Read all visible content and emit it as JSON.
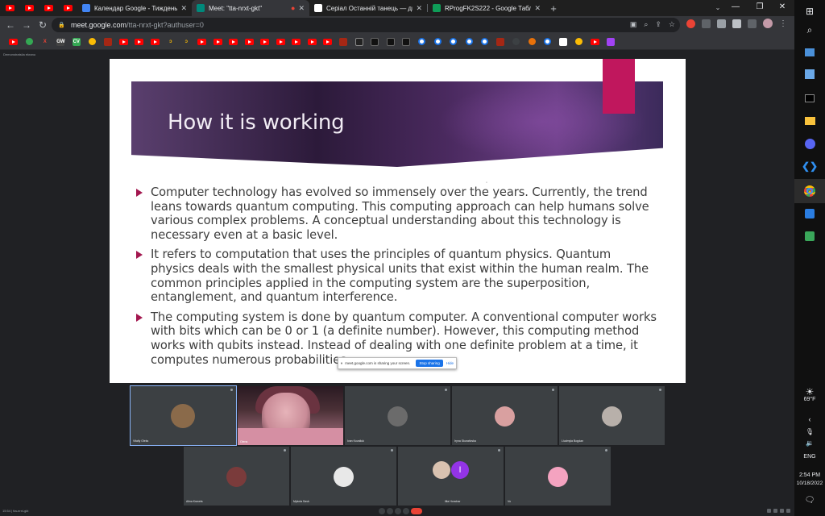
{
  "browser": {
    "tabs": [
      {
        "title": "Календар Google - Тиждень (16",
        "icon": "google-calendar-icon",
        "color": "#4285f4"
      },
      {
        "title": "Meet: \"tta-nrxt-gkt\"",
        "icon": "google-meet-icon",
        "color": "#00897b",
        "active": true
      },
      {
        "title": "Серіал Останній танець — диво",
        "icon": "mx-site-icon",
        "color": "#ffffff"
      },
      {
        "title": "RProgFK2S222 - Google Таблиці",
        "icon": "google-sheets-icon",
        "color": "#0f9d58"
      }
    ],
    "new_tab_label": "+",
    "window_controls": {
      "minimize": "—",
      "maximize": "❐",
      "close": "✕"
    },
    "url_host": "meet.google.com",
    "url_path": "/tta-nrxt-gkt?authuser=0"
  },
  "meet": {
    "top_label": "Demonstratsiia ekranu",
    "slide": {
      "title": "How it is working",
      "bullets": [
        "Computer technology has evolved so immensely over the years. Currently, the trend leans towards quantum computing. This computing approach can help humans solve various complex problems. A conceptual understanding about this technology is necessary even at a basic level.",
        "It refers to computation that uses the principles of quantum physics. Quantum physics deals with the smallest physical units that exist within the human realm. The common principles applied in the computing system are the superposition, entanglement, and quantum interference.",
        "The computing system is done by quantum computer. A conventional computer works with bits which can be 0 or 1 (a definite number). However, this computing method works with qubits instead. Instead of dealing with one definite problem at a time, it computes numerous probabilities"
      ]
    },
    "share_bar": {
      "message": "meet.google.com is sharing your screen.",
      "stop_label": "Stop sharing",
      "hide_label": "Hide"
    },
    "participants": [
      {
        "name": "Vitaliy Oleks",
        "avatar_color": "#8a6a4a"
      },
      {
        "name": "Olena",
        "avatar_color": "#c98b97"
      },
      {
        "name": "Ivan Kovaliuk",
        "avatar_color": "#6b6b6b"
      },
      {
        "name": "Iryna Skurativska",
        "avatar_color": "#d9a0a0"
      },
      {
        "name": "Liudmyla Bogdan",
        "avatar_color": "#b8b0aa"
      },
      {
        "name": "Alina Kravets",
        "avatar_color": "#7a3b3b"
      },
      {
        "name": "Mykola Savk",
        "avatar_color": "#e8e8e8"
      },
      {
        "name": "Illia Honchar",
        "avatar_color": "#9334e6",
        "initial": "I"
      },
      {
        "name": "Vo",
        "avatar_color": "#f4a3c0"
      }
    ],
    "bottom_left": "15:54 | tta-nrxt-gkt"
  },
  "taskbar": {
    "weather_temp": "69°F",
    "language": "ENG",
    "time": "2:54 PM",
    "date": "10/18/2022"
  }
}
